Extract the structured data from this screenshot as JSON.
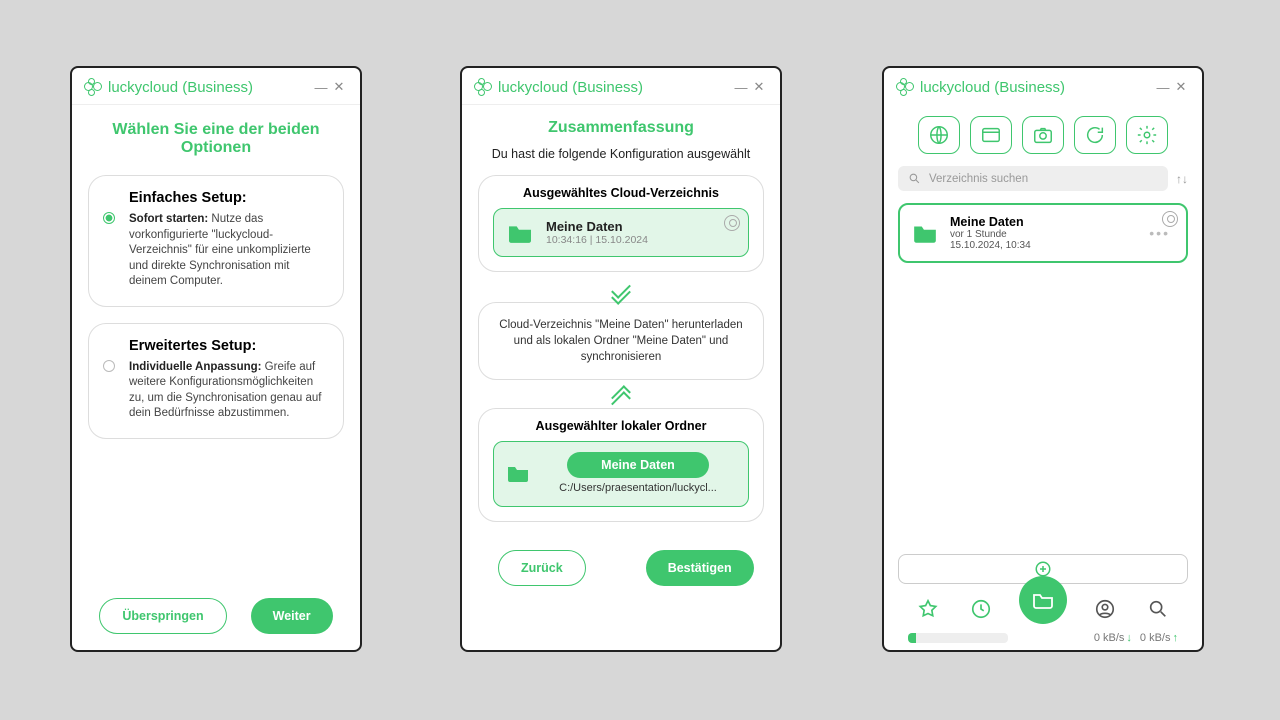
{
  "appTitle": "luckycloud (Business)",
  "w1": {
    "heading": "Wählen Sie eine der beiden Optionen",
    "opt1": {
      "title": "Einfaches Setup:",
      "lead": "Sofort starten:",
      "body": " Nutze das vorkonfigurierte \"luckycloud-Verzeichnis\" für eine unkomplizierte und direkte Synchronisation mit deinem Computer."
    },
    "opt2": {
      "title": "Erweitertes Setup:",
      "lead": "Individuelle Anpassung:",
      "body": " Greife auf weitere Konfigurationsmöglichkeiten zu, um die Synchronisation genau auf dein Bedürfnisse abzustimmen."
    },
    "skip": "Überspringen",
    "next": "Weiter"
  },
  "w2": {
    "heading": "Zusammenfassung",
    "sub": "Du hast die folgende Konfiguration ausgewählt",
    "cloudTitle": "Ausgewähltes Cloud-Verzeichnis",
    "cloudName": "Meine Daten",
    "cloudTime": "10:34:16 | 15.10.2024",
    "desc": "Cloud-Verzeichnis \"Meine Daten\" herunterladen und als lokalen Ordner \"Meine Daten\" und synchronisieren",
    "localTitle": "Ausgewählter lokaler Ordner",
    "localName": "Meine Daten",
    "localPath": "C:/Users/praesentation/luckycl...",
    "back": "Zurück",
    "confirm": "Bestätigen"
  },
  "w3": {
    "searchPlaceholder": "Verzeichnis suchen",
    "dirName": "Meine Daten",
    "dirSub": "vor 1 Stunde",
    "dirDate": "15.10.2024, 10:34",
    "down": "0 kB/s",
    "up": "0 kB/s"
  }
}
